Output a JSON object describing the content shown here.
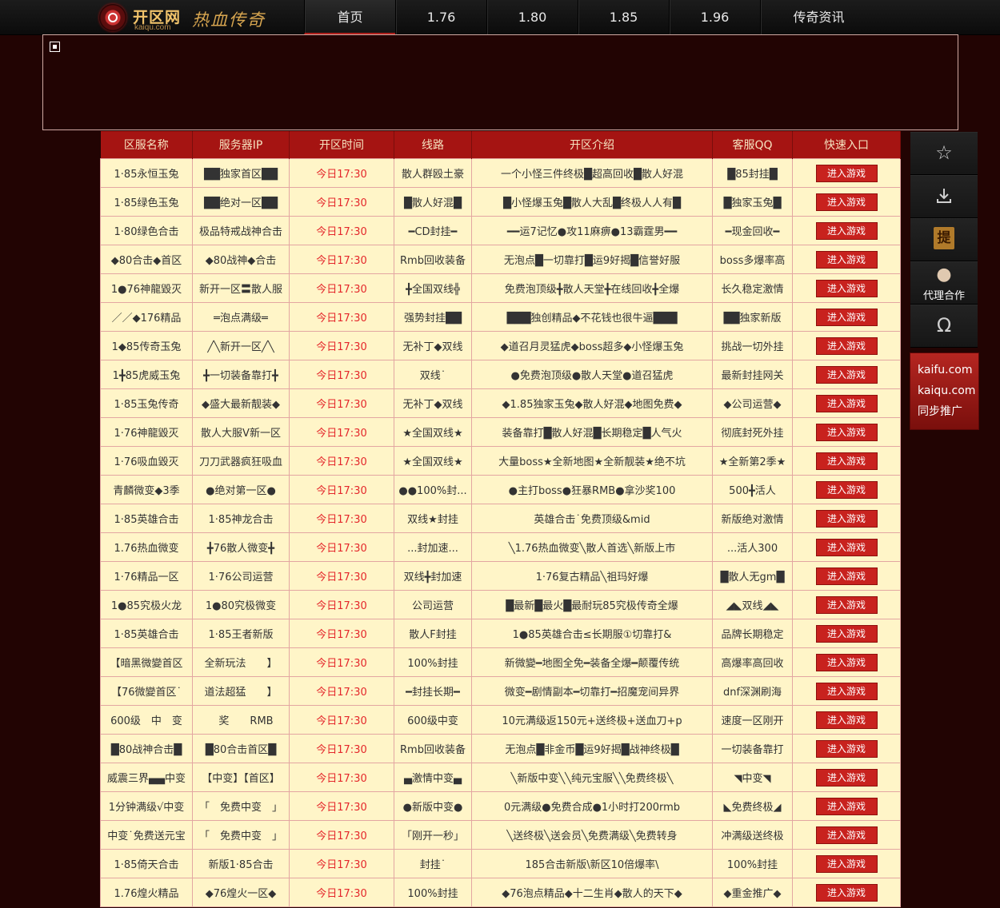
{
  "header": {
    "logo_name": "开区网",
    "logo_domain": "kaiqu.com",
    "logo_slogan": "热血传奇",
    "nav": [
      "首页",
      "1.76",
      "1.80",
      "1.85",
      "1.96",
      "传奇资讯"
    ]
  },
  "table": {
    "headers": [
      "区服名称",
      "服务器IP",
      "开区时间",
      "线路",
      "开区介绍",
      "客服QQ",
      "快速入口"
    ],
    "button_label": "进入游戏",
    "rows": [
      [
        "1·85永恒玉兔",
        "██独家首区██",
        "今日17:30",
        "散人群殴土豪",
        "一个小怪三件终极█超高回收█散人好混",
        "█85封挂█"
      ],
      [
        "1·85绿色玉兔",
        "██绝对一区██",
        "今日17:30",
        "█散人好混█",
        "█小怪爆玉兔█散人大乱█终极人人有█",
        "█独家玉兔█"
      ],
      [
        "1·80绿色合击",
        "极品特戒战神合击",
        "今日17:30",
        "━CD封挂━",
        "━━运7记忆●攻11麻痹●13霸霆男━━",
        "━现金回收━"
      ],
      [
        "◆80合击◆首区",
        "◆80战神◆合击",
        "今日17:30",
        "Rmb回收装备",
        "无泡点█一切靠打█运9好揭█信誉好服",
        "boss多爆率高"
      ],
      [
        "1●76神龍毀灭",
        "新开一区〓散人服",
        "今日17:30",
        "╋全国双线╬",
        "免费泡顶级╋散人天堂╋在线回收╋全爆",
        "长久稳定激情"
      ],
      [
        "／／◆176精品",
        "═泡点满级═",
        "今日17:30",
        "强势封挂██",
        "███独创精品◆不花钱也很牛逼███",
        "██独家新版"
      ],
      [
        "1◆85传奇玉兔",
        "╱╲新开一区╱╲",
        "今日17:30",
        "无补丁◆双线",
        "◆道召月灵猛虎◆boss超多◆小怪爆玉兔",
        "挑战一切外挂"
      ],
      [
        "1╋85虎威玉兔",
        "╋一切装备靠打╋",
        "今日17:30",
        "双线˙",
        "●免费泡顶级●散人天堂●道召猛虎",
        "最新封挂网关"
      ],
      [
        "1·85玉兔传奇",
        "◆盛大最新靓装◆",
        "今日17:30",
        "无补丁◆双线",
        "◆1.85独家玉兔◆散人好混◆地图免费◆",
        "◆公司运营◆"
      ],
      [
        "1·76神龍毀灭",
        "散人大服V新一区",
        "今日17:30",
        "★全国双线★",
        "装备靠打█散人好混█长期稳定█人气火",
        "彻底封死外挂"
      ],
      [
        "1·76吸血毀灭",
        "刀刀武器疯狂吸血",
        "今日17:30",
        "★全国双线★",
        "大量boss★全新地图★全新靓装★绝不坑",
        "★全新第2季★"
      ],
      [
        "青麟微变◆3季",
        "●绝对第一区●",
        "今日17:30",
        "●●100%封...",
        "●主打boss●狂暴RMB●拿沙奖100",
        "500╋活人"
      ],
      [
        "1·85英雄合击",
        "1·85神龙合击",
        "今日17:30",
        "双线★封挂",
        "英雄合击˙免费顶级&mid",
        "新版绝对激情"
      ],
      [
        "1.76热血微变",
        "╋76散人微变╋",
        "今日17:30",
        "...封加速...",
        "╲1.76热血微变╲散人首选╲新版上市",
        "...活人300"
      ],
      [
        "1·76精品一区",
        "1·76公司运营",
        "今日17:30",
        "双线╋封加速",
        "1·76复古精品╲祖玛好爆",
        "█散人无gm█"
      ],
      [
        "1●85究极火龙",
        "1●80究极微变",
        "今日17:30",
        "公司运营",
        "█最新█最火█最耐玩85究极传奇全爆",
        "◢◣双线◢◣"
      ],
      [
        "1·85英雄合击",
        "1·85王者新版",
        "今日17:30",
        "散人F封挂",
        "1●85英雄合击≤长期服①切靠打&",
        "品牌长期稳定"
      ],
      [
        "【暗黑微變首区",
        "全新玩法　　】",
        "今日17:30",
        "100%封挂",
        "新微變━地图全免━装备全爆━颠覆传统",
        "高爆率高回收"
      ],
      [
        "【76微變首区˙",
        "道法超猛　　】",
        "今日17:30",
        "━封挂长期━",
        "微变━剧情副本━切靠打━招魔宠间异界",
        "dnf深渊刷海"
      ],
      [
        "600级　中　变",
        "　奖　　RMB",
        "今日17:30",
        "600级中变",
        "10元满级返150元+送终极+送血刀+p",
        "速度一区刚开"
      ],
      [
        "█80战神合击█",
        "█80合击首区█",
        "今日17:30",
        "Rmb回收装备",
        "无泡点█非金币█运9好揭█战神终极█",
        "一切装备靠打"
      ],
      [
        "威震三界▄▄中变",
        "【中变】【首区】",
        "今日17:30",
        "▄激情中变▄",
        "╲新版中变╲╲纯元宝服╲╲免费终极╲",
        "◥中变◥"
      ],
      [
        "1分钟满级√中变",
        "「　免费中变　」",
        "今日17:30",
        "●新版中变●",
        "0元满级●免费合成●1小时打200rmb",
        "◣免费终极◢"
      ],
      [
        "中变˙免费送元宝",
        "「　免费中变　」",
        "今日17:30",
        "「刚开一秒」",
        "╲送终极╲送会员╲免费满级╲免费转身",
        "冲满级送终极"
      ],
      [
        "1·85倚天合击",
        "新版1·85合击",
        "今日17:30",
        "封挂˙",
        "185合击新版\\新区10倍爆率\\",
        "100%封挂"
      ],
      [
        "1.76煌火精品",
        "◆76煌火一区◆",
        "今日17:30",
        "100%封挂",
        "◆76泡点精品◆十二生肖◆散人的天下◆",
        "◆重金推广◆"
      ]
    ]
  },
  "sidebar": {
    "icons": [
      "star-icon",
      "download-icon",
      "bookmark-icon",
      "agent-icon",
      "omega-icon"
    ],
    "agent_label": "代理合作",
    "bookmark_glyph": "提"
  },
  "promo": {
    "lines": [
      "kaifu.com",
      "kaiqu.com",
      "同步推广"
    ]
  }
}
